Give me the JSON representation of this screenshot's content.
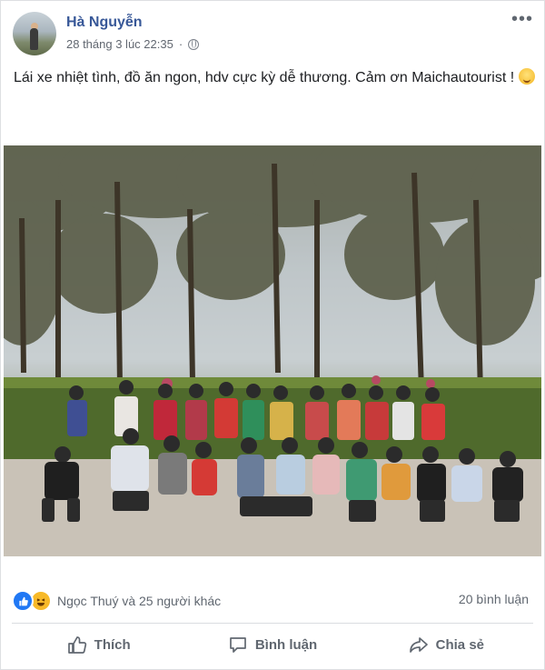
{
  "post": {
    "author": "Hà Nguyễn",
    "timestamp": "28 tháng 3 lúc 22:35",
    "privacy_icon": "globe-icon",
    "more_icon": "more-options-icon",
    "text": "Lái xe nhiệt tình, đồ ăn ngon, hdv cực kỳ dễ thương. Cảm ơn Maichautourist !",
    "emoji_icon": "smiling-face-emoji"
  },
  "reactions": {
    "icons": [
      "like-reaction-icon",
      "haha-reaction-icon"
    ],
    "names": "Ngọc Thuý và 25 người khác",
    "comments": "20 bình luận"
  },
  "actions": {
    "like": "Thích",
    "comment": "Bình luận",
    "share": "Chia sẻ"
  },
  "colors": {
    "author_link": "#385898",
    "meta_text": "#616770",
    "like_blue": "#2078f4",
    "haha_yellow": "#f7b928"
  }
}
